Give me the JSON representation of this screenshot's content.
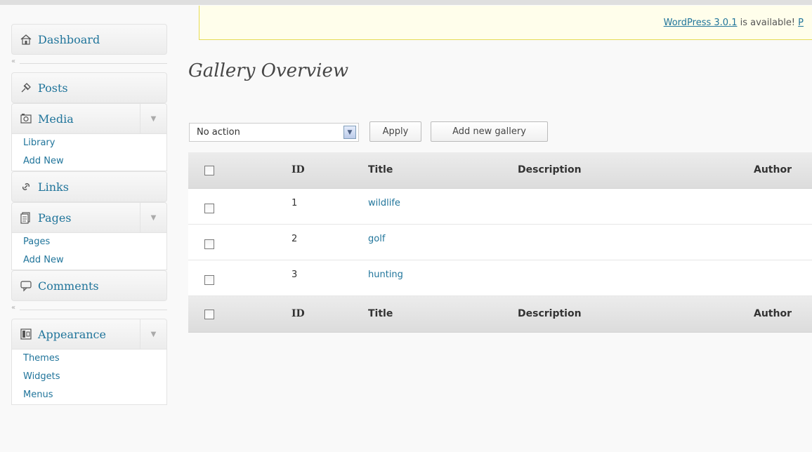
{
  "sidebar": {
    "dashboard": {
      "label": "Dashboard"
    },
    "posts": {
      "label": "Posts"
    },
    "media": {
      "label": "Media",
      "items": [
        {
          "label": "Library"
        },
        {
          "label": "Add New"
        }
      ]
    },
    "links": {
      "label": "Links"
    },
    "pages": {
      "label": "Pages",
      "items": [
        {
          "label": "Pages"
        },
        {
          "label": "Add New"
        }
      ]
    },
    "comments": {
      "label": "Comments"
    },
    "appearance": {
      "label": "Appearance",
      "items": [
        {
          "label": "Themes"
        },
        {
          "label": "Widgets"
        },
        {
          "label": "Menus"
        }
      ]
    },
    "collapse_glyph": "«",
    "toggle_glyph": "▼"
  },
  "nag": {
    "link": "WordPress 3.0.1",
    "text": " is available! ",
    "trailing": "P"
  },
  "page": {
    "title": "Gallery Overview"
  },
  "toolbar": {
    "bulk_action": "No action",
    "apply_label": "Apply",
    "add_label": "Add new gallery"
  },
  "table": {
    "columns": {
      "id": "ID",
      "title": "Title",
      "description": "Description",
      "author": "Author"
    },
    "rows": [
      {
        "id": "1",
        "title": "wildlife",
        "description": "",
        "author": ""
      },
      {
        "id": "2",
        "title": "golf",
        "description": "",
        "author": ""
      },
      {
        "id": "3",
        "title": "hunting",
        "description": "",
        "author": ""
      }
    ]
  },
  "colors": {
    "link": "#21759b",
    "nag_bg": "#fffeeb",
    "nag_border": "#e6db55",
    "page_bg": "#f9f9f9"
  },
  "icons": [
    "home-icon",
    "pin-icon",
    "camera-icon",
    "link-icon",
    "pages-icon",
    "comment-icon",
    "appearance-icon"
  ]
}
